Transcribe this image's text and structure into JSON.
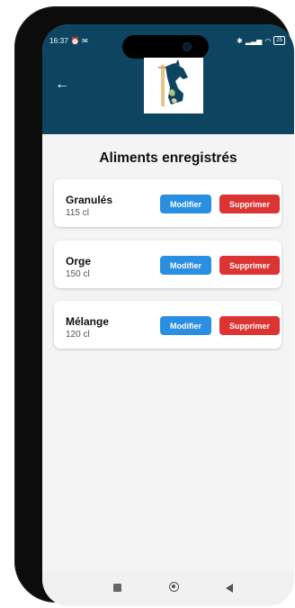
{
  "status_bar": {
    "time": "16:37",
    "alarm_icon": "alarm-clock-icon",
    "mail_icon": "mail-icon",
    "bluetooth_icon": "bluetooth-icon",
    "signal_icon": "signal-icon",
    "wifi_icon": "wifi-icon",
    "battery": "25"
  },
  "header": {
    "back_icon": "arrow-left-icon",
    "back_symbol": "←",
    "logo_icon": "horse-head-logo",
    "background_color": "#0d4560"
  },
  "main": {
    "title": "Aliments enregistrés",
    "items": [
      {
        "name": "Granulés",
        "quantity": "115 cl",
        "edit_label": "Modifier",
        "delete_label": "Supprimer"
      },
      {
        "name": "Orge",
        "quantity": "150 cl",
        "edit_label": "Modifier",
        "delete_label": "Supprimer"
      },
      {
        "name": "Mélange",
        "quantity": "120 cl",
        "edit_label": "Modifier",
        "delete_label": "Supprimer"
      }
    ]
  },
  "colors": {
    "edit_button": "#2a8fe0",
    "delete_button": "#dc3333"
  },
  "nav_bar": {
    "recent_icon": "square-recent-apps-icon",
    "home_icon": "circle-home-icon",
    "back_icon": "triangle-back-icon"
  }
}
